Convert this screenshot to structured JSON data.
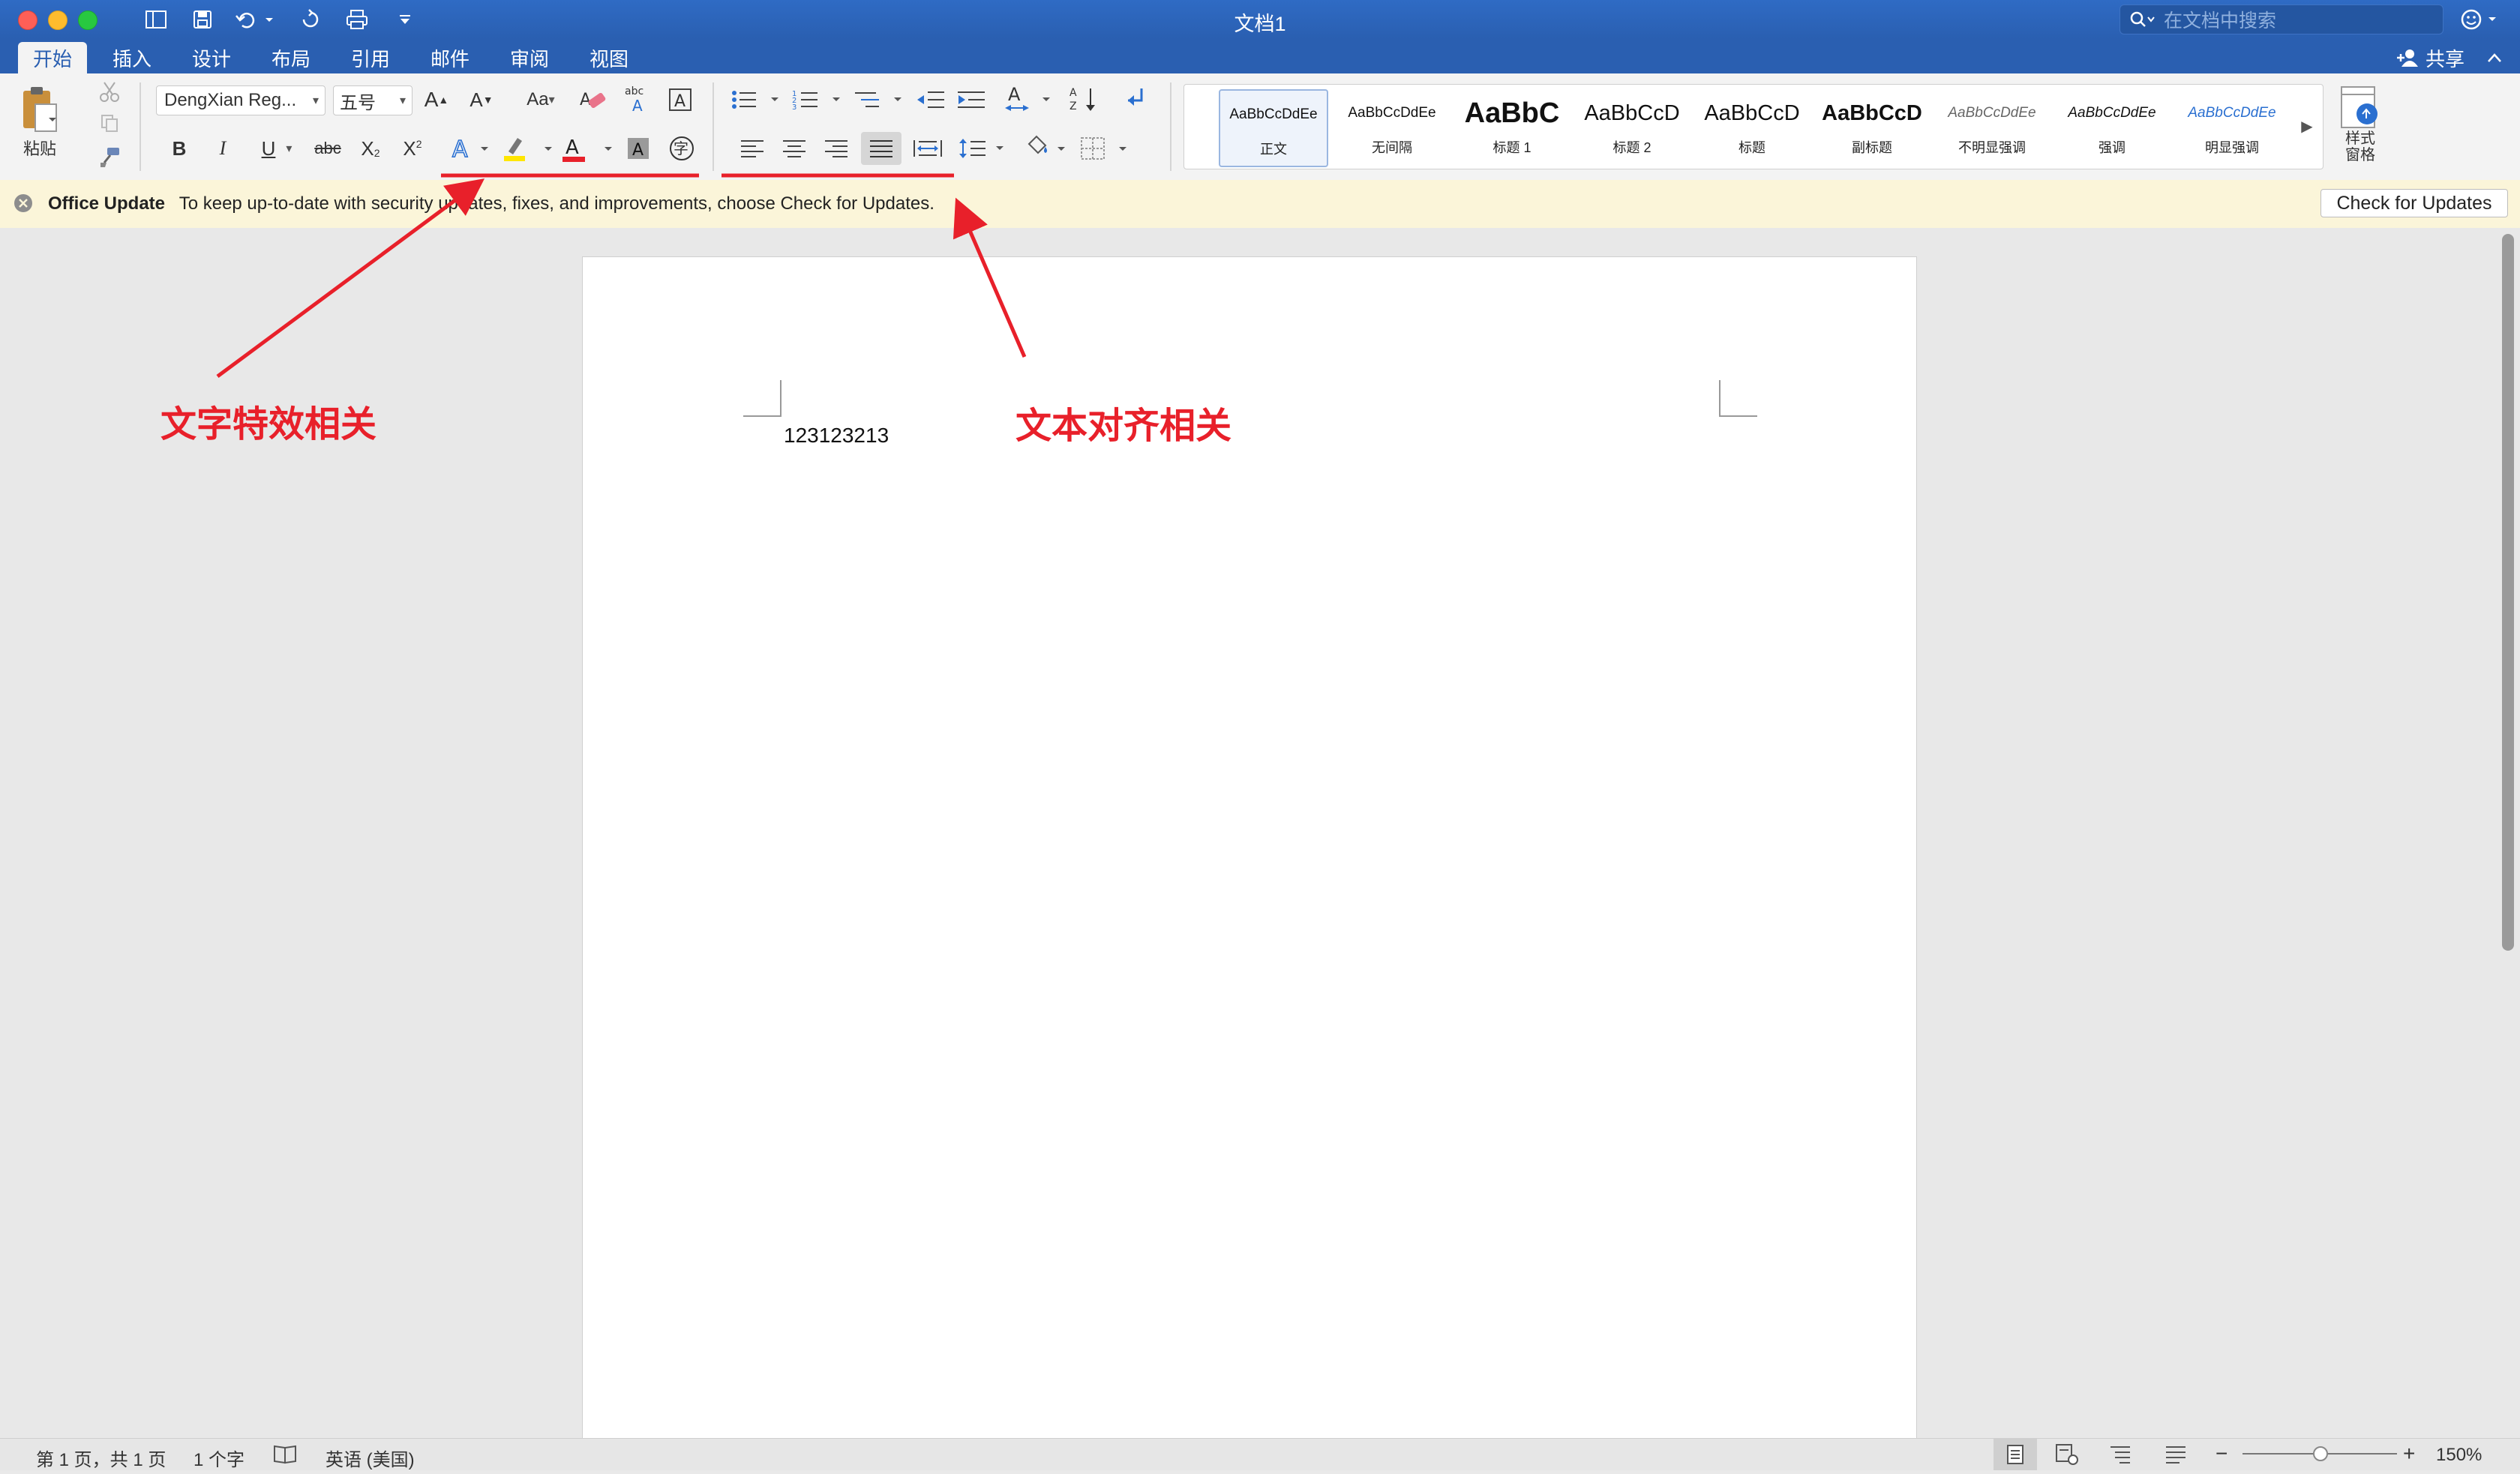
{
  "window": {
    "title": "文档1"
  },
  "search": {
    "placeholder": "在文档中搜索"
  },
  "share": {
    "label": "共享"
  },
  "tabs": [
    {
      "label": "开始",
      "active": true
    },
    {
      "label": "插入"
    },
    {
      "label": "设计"
    },
    {
      "label": "布局"
    },
    {
      "label": "引用"
    },
    {
      "label": "邮件"
    },
    {
      "label": "审阅"
    },
    {
      "label": "视图"
    }
  ],
  "ribbon": {
    "paste_label": "粘贴",
    "font_name": "DengXian Reg...",
    "font_size": "五号",
    "styles_pane_label_line1": "样式",
    "styles_pane_label_line2": "窗格",
    "styles": [
      {
        "preview": "AaBbCcDdEe",
        "label": "正文",
        "selected": true
      },
      {
        "preview": "AaBbCcDdEe",
        "label": "无间隔"
      },
      {
        "preview": "AaBbC",
        "label": "标题 1"
      },
      {
        "preview": "AaBbCcD",
        "label": "标题 2"
      },
      {
        "preview": "AaBbCcD",
        "label": "标题"
      },
      {
        "preview": "AaBbCcD",
        "label": "副标题"
      },
      {
        "preview": "AaBbCcDdEe",
        "label": "不明显强调"
      },
      {
        "preview": "AaBbCcDdEe",
        "label": "强调"
      },
      {
        "preview": "AaBbCcDdEe",
        "label": "明显强调"
      }
    ]
  },
  "update_bar": {
    "title": "Office Update",
    "message": "To keep up-to-date with security updates, fixes, and improvements, choose Check for Updates.",
    "button": "Check for Updates"
  },
  "document": {
    "text": "123123213"
  },
  "status": {
    "page": "第 1 页，共 1 页",
    "words": "1 个字",
    "language": "英语 (美国)",
    "zoom": "150%"
  },
  "annotations": [
    {
      "text": "文字特效相关"
    },
    {
      "text": "文本对齐相关"
    }
  ],
  "colors": {
    "title_bar": "#2a5fb1",
    "annotation_red": "#e8202a",
    "update_bar": "#fbf5d9"
  }
}
